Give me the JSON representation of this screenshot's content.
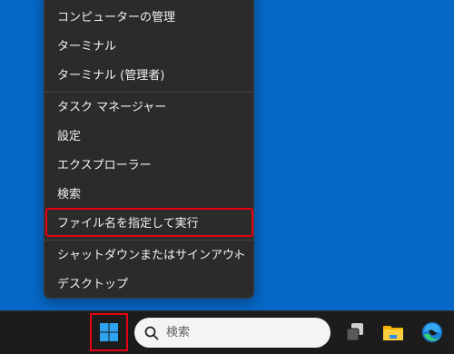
{
  "context_menu": {
    "items": [
      {
        "label": "コンピューターの管理"
      },
      {
        "label": "ターミナル"
      },
      {
        "label": "ターミナル (管理者)"
      },
      {
        "label": "タスク マネージャー"
      },
      {
        "label": "設定"
      },
      {
        "label": "エクスプローラー"
      },
      {
        "label": "検索"
      },
      {
        "label": "ファイル名を指定して実行"
      },
      {
        "label": "シャットダウンまたはサインアウト",
        "submenu_glyph": "›"
      },
      {
        "label": "デスクトップ"
      }
    ]
  },
  "taskbar": {
    "search": {
      "placeholder": "検索"
    },
    "icons": [
      "start-icon",
      "search-icon",
      "task-view-icon",
      "file-explorer-icon",
      "edge-icon"
    ]
  },
  "colors": {
    "desktop": "#0767c6",
    "menu_bg": "#2b2b2b",
    "taskbar_bg": "#1c1c1c",
    "highlight": "#e60012"
  }
}
